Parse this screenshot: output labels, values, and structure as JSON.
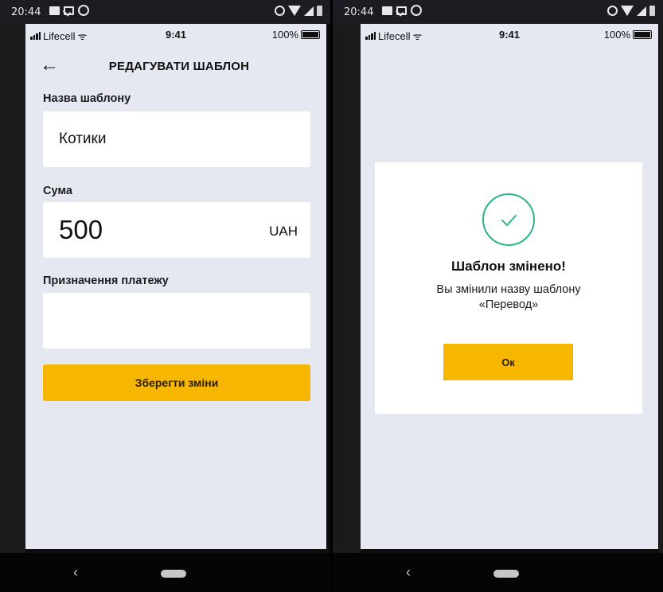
{
  "android_status": {
    "time": "20:44"
  },
  "ios_status": {
    "carrier": "Lifecell",
    "time": "9:41",
    "battery": "100%"
  },
  "edit_screen": {
    "back_icon": "←",
    "title": "РЕДАГУВАТИ ШАБЛОН",
    "name_label": "Назва шаблону",
    "name_value": "Котики",
    "amount_label": "Сума",
    "amount_value": "500",
    "currency": "UAH",
    "purpose_label": "Призначення платежу",
    "purpose_value": "",
    "save_label": "Зберегти зміни"
  },
  "dialog": {
    "icon": "check-circle-icon",
    "title": "Шаблон змінено!",
    "message_line1": "Вы змінили назву шаблону",
    "message_line2": "«Перевод»",
    "ok_label": "Ок"
  },
  "nav": {
    "back_glyph": "‹"
  },
  "colors": {
    "accent": "#f7b700",
    "success": "#2bb58a",
    "background": "#e6e8f1"
  }
}
